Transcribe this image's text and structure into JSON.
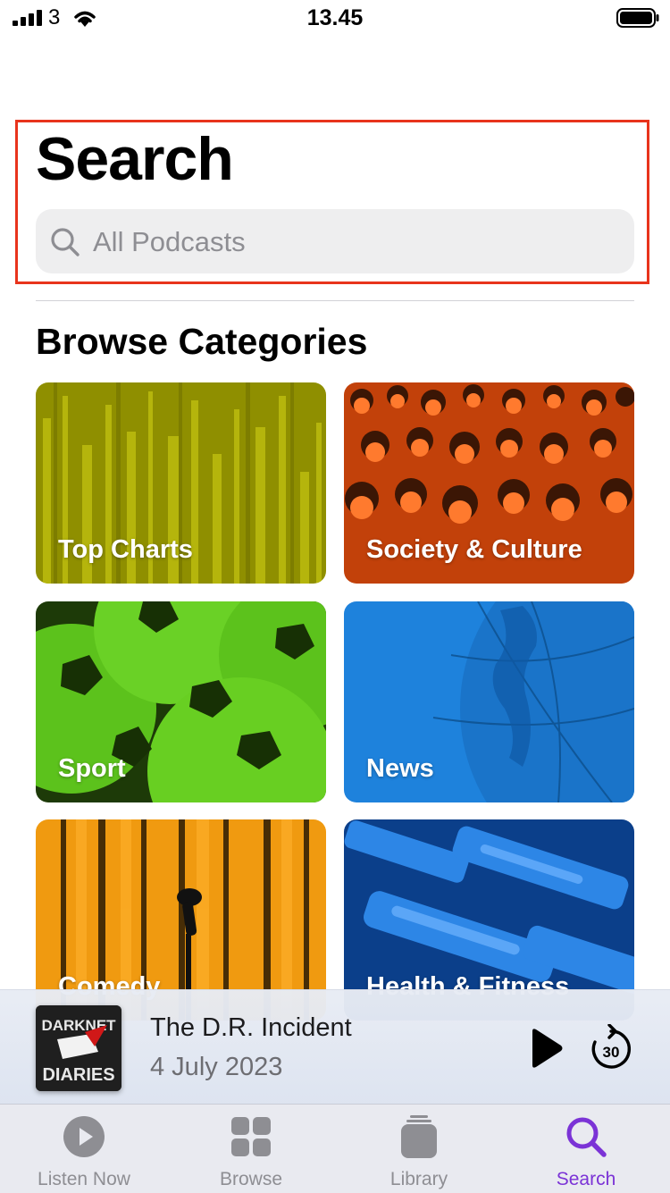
{
  "status_bar": {
    "carrier": "3",
    "time": "13.45"
  },
  "header": {
    "title": "Search",
    "search_placeholder": "All Podcasts"
  },
  "browse": {
    "title": "Browse Categories",
    "categories": [
      {
        "label": "Top Charts",
        "color": "#a8a800"
      },
      {
        "label": "Society & Culture",
        "color": "#e04e10"
      },
      {
        "label": "Sport",
        "color": "#5dc21a"
      },
      {
        "label": "News",
        "color": "#1f86e0"
      },
      {
        "label": "Comedy",
        "color": "#f09a10"
      },
      {
        "label": "Health & Fitness",
        "color": "#1c6fd8"
      }
    ]
  },
  "now_playing": {
    "artwork_text_top": "DARKNET",
    "artwork_text_bottom": "DIARIES",
    "title": "The D.R. Incident",
    "date": "4 July 2023",
    "skip_seconds": "30"
  },
  "tab_bar": {
    "tabs": [
      {
        "label": "Listen Now",
        "icon": "play-circle-icon"
      },
      {
        "label": "Browse",
        "icon": "grid-icon"
      },
      {
        "label": "Library",
        "icon": "library-stack-icon"
      },
      {
        "label": "Search",
        "icon": "search-icon",
        "active": true
      }
    ],
    "active_color": "#7b33d6"
  }
}
